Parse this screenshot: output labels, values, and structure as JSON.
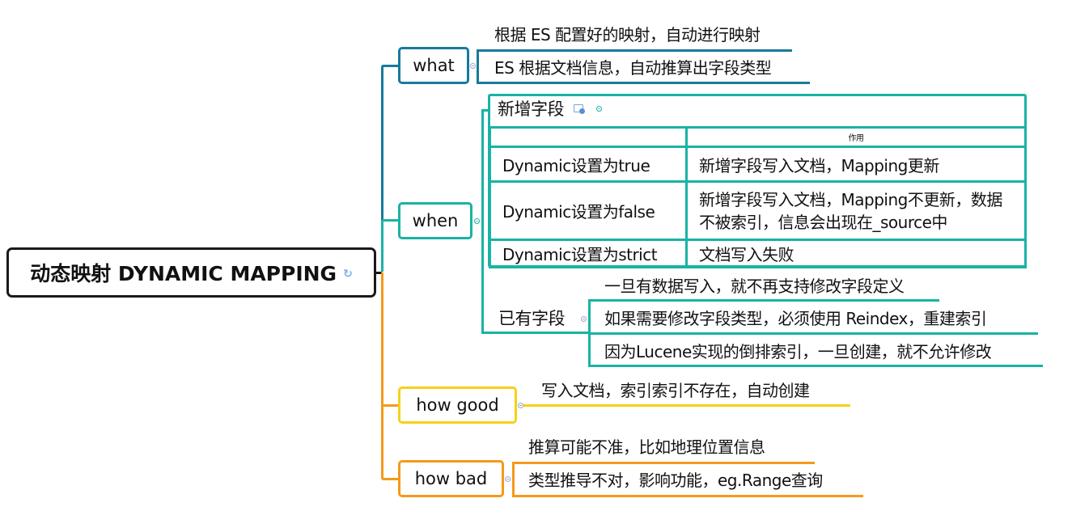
{
  "root": {
    "label": "动态映射 DYNAMIC MAPPING",
    "icon": "refresh-icon"
  },
  "colors": {
    "root_border": "#1a1a1a",
    "what": "#177a9c",
    "when": "#19b3a4",
    "how_good": "#f5d11a",
    "how_bad": "#f59a1a"
  },
  "branches": {
    "what": {
      "label": "what",
      "children": [
        "根据 ES 配置好的映射，自动进行映射",
        "ES 根据文档信息，自动推算出字段类型"
      ]
    },
    "when": {
      "label": "when",
      "new_fields": {
        "title": "新增字段",
        "table": {
          "header": [
            "",
            "作用"
          ],
          "rows": [
            [
              "Dynamic设置为true",
              "新增字段写入文档，Mapping更新"
            ],
            [
              "Dynamic设置为false",
              "新增字段写入文档，Mapping不更新，数据不被索引，信息会出现在_source中"
            ],
            [
              "Dynamic设置为strict",
              "文档写入失败"
            ]
          ]
        }
      },
      "existing_fields": {
        "title": "已有字段",
        "children": [
          "一旦有数据写入，就不再支持修改字段定义",
          "如果需要修改字段类型，必须使用 Reindex，重建索引",
          "因为Lucene实现的倒排索引，一旦创建，就不允许修改"
        ]
      }
    },
    "how_good": {
      "label": "how good",
      "children": [
        "写入文档，索引索引不存在，自动创建"
      ]
    },
    "how_bad": {
      "label": "how bad",
      "children": [
        "推算可能不准，比如地理位置信息",
        "类型推导不对，影响功能，eg.Range查询"
      ]
    }
  }
}
